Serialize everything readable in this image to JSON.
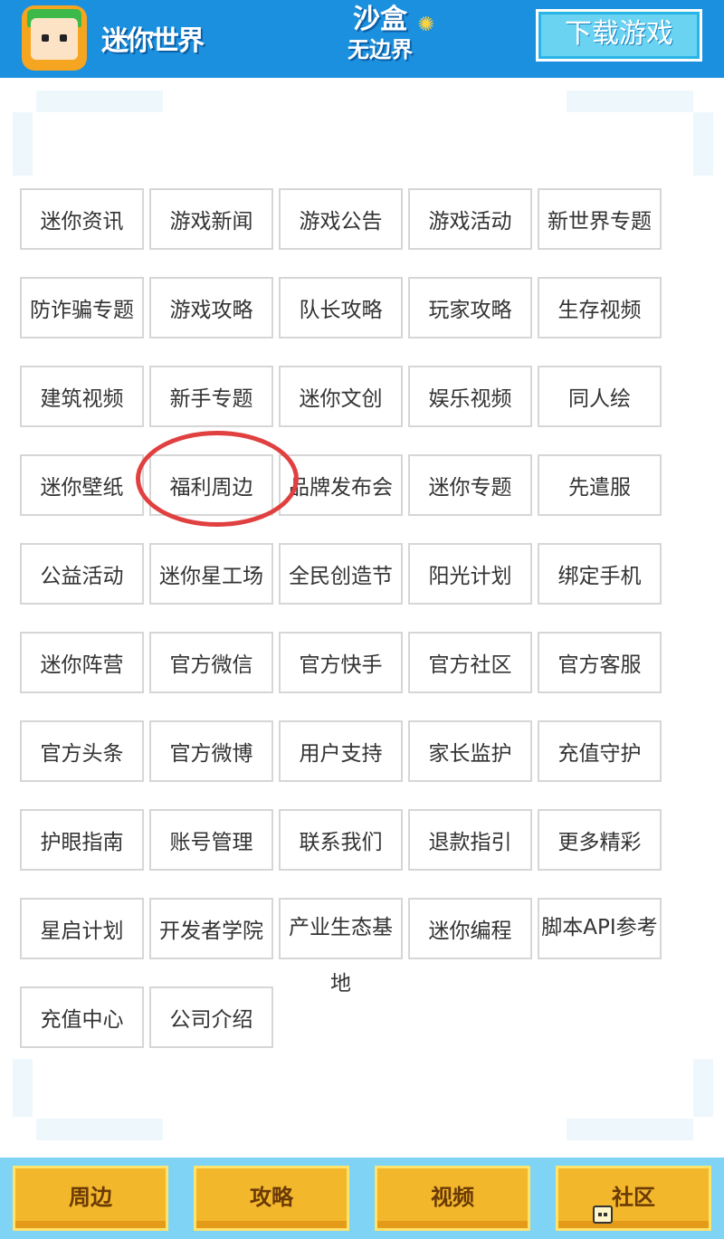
{
  "header": {
    "logo_text": "迷你世界",
    "center_logo_line1": "沙盒",
    "center_logo_line2": "无边界",
    "download_label": "下载游戏",
    "brand_color": "#1b90de"
  },
  "grid": {
    "items": [
      "迷你资讯",
      "游戏新闻",
      "游戏公告",
      "游戏活动",
      "新世界专题",
      "防诈骗专题",
      "游戏攻略",
      "队长攻略",
      "玩家攻略",
      "生存视频",
      "建筑视频",
      "新手专题",
      "迷你文创",
      "娱乐视频",
      "同人绘",
      "迷你壁纸",
      "福利周边",
      "品牌发布会",
      "迷你专题",
      "先遣服",
      "公益活动",
      "迷你星工场",
      "全民创造节",
      "阳光计划",
      "绑定手机",
      "迷你阵营",
      "官方微信",
      "官方快手",
      "官方社区",
      "官方客服",
      "官方头条",
      "官方微博",
      "用户支持",
      "家长监护",
      "充值守护",
      "护眼指南",
      "账号管理",
      "联系我们",
      "退款指引",
      "更多精彩",
      "星启计划",
      "开发者学院",
      "产业生态基地",
      "迷你编程",
      "脚本API参考",
      "充值中心",
      "公司介绍"
    ],
    "highlight_color": "#e0403f"
  },
  "bottom_nav": {
    "items": [
      "周边",
      "攻略",
      "视频",
      "社区"
    ],
    "button_color": "#f3b72c"
  }
}
